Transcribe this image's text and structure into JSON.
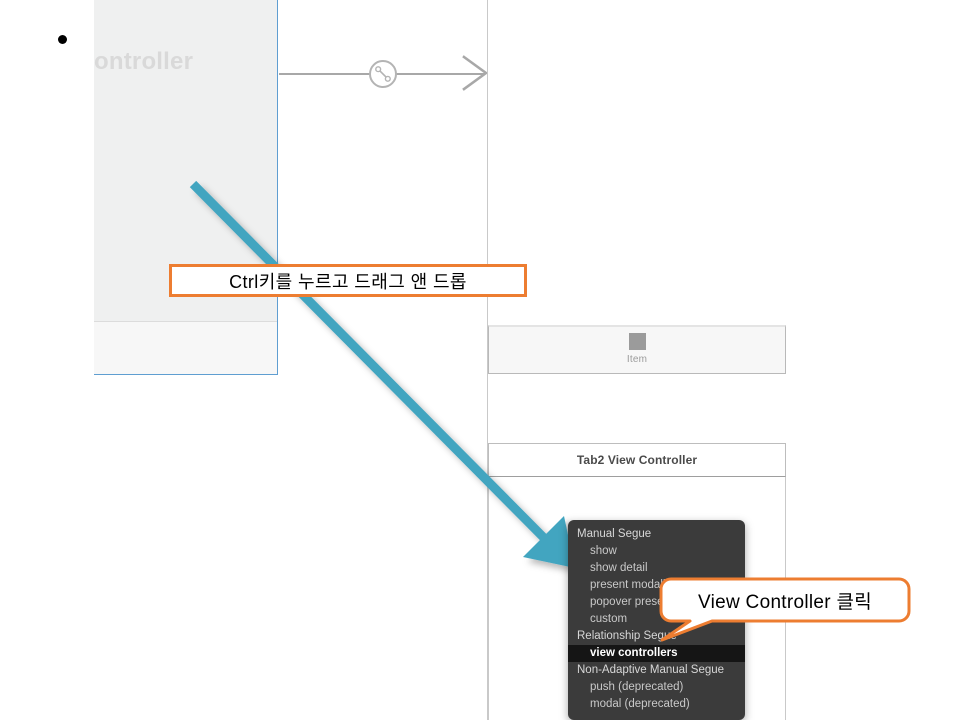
{
  "slide": {
    "bullet_marker": "bullet-dot"
  },
  "storyboard": {
    "left_scene": {
      "title_clipped": "ontroller"
    },
    "segue_connector": {
      "badge_icon": "segue-badge-icon",
      "arrow_icon": "segue-arrow-icon"
    },
    "tab_bar": {
      "item_icon": "tab-item-square-icon",
      "item_label": "Item"
    },
    "tab2_scene": {
      "title": "Tab2 View Controller"
    }
  },
  "segue_menu": {
    "groups": [
      {
        "header": "Manual Segue",
        "items": [
          {
            "label": "show",
            "selected": false
          },
          {
            "label": "show detail",
            "selected": false
          },
          {
            "label": "present modally",
            "selected": false
          },
          {
            "label": "popover presentation",
            "selected": false
          },
          {
            "label": "custom",
            "selected": false
          }
        ]
      },
      {
        "header": "Relationship Segue",
        "items": [
          {
            "label": "view controllers",
            "selected": true
          }
        ]
      },
      {
        "header": "Non-Adaptive Manual Segue",
        "items": [
          {
            "label": "push (deprecated)",
            "selected": false
          },
          {
            "label": "modal (deprecated)",
            "selected": false
          }
        ]
      }
    ]
  },
  "annotations": {
    "drag_arrow": {
      "icon": "drag-arrow-icon",
      "color": "#43a5c0"
    },
    "callout_rect": {
      "text": "Ctrl키를 누르고 드래그 앤 드롭",
      "border_color": "#ed7d31"
    },
    "callout_bubble": {
      "text": "View Controller 클릭",
      "border_color": "#ed7d31"
    }
  },
  "colors": {
    "teal": "#43a5c0",
    "orange": "#ed7d31",
    "scene_border_blue": "#5f9ed1",
    "menu_bg": "#3b3b3b",
    "menu_selected_bg": "#151515"
  }
}
